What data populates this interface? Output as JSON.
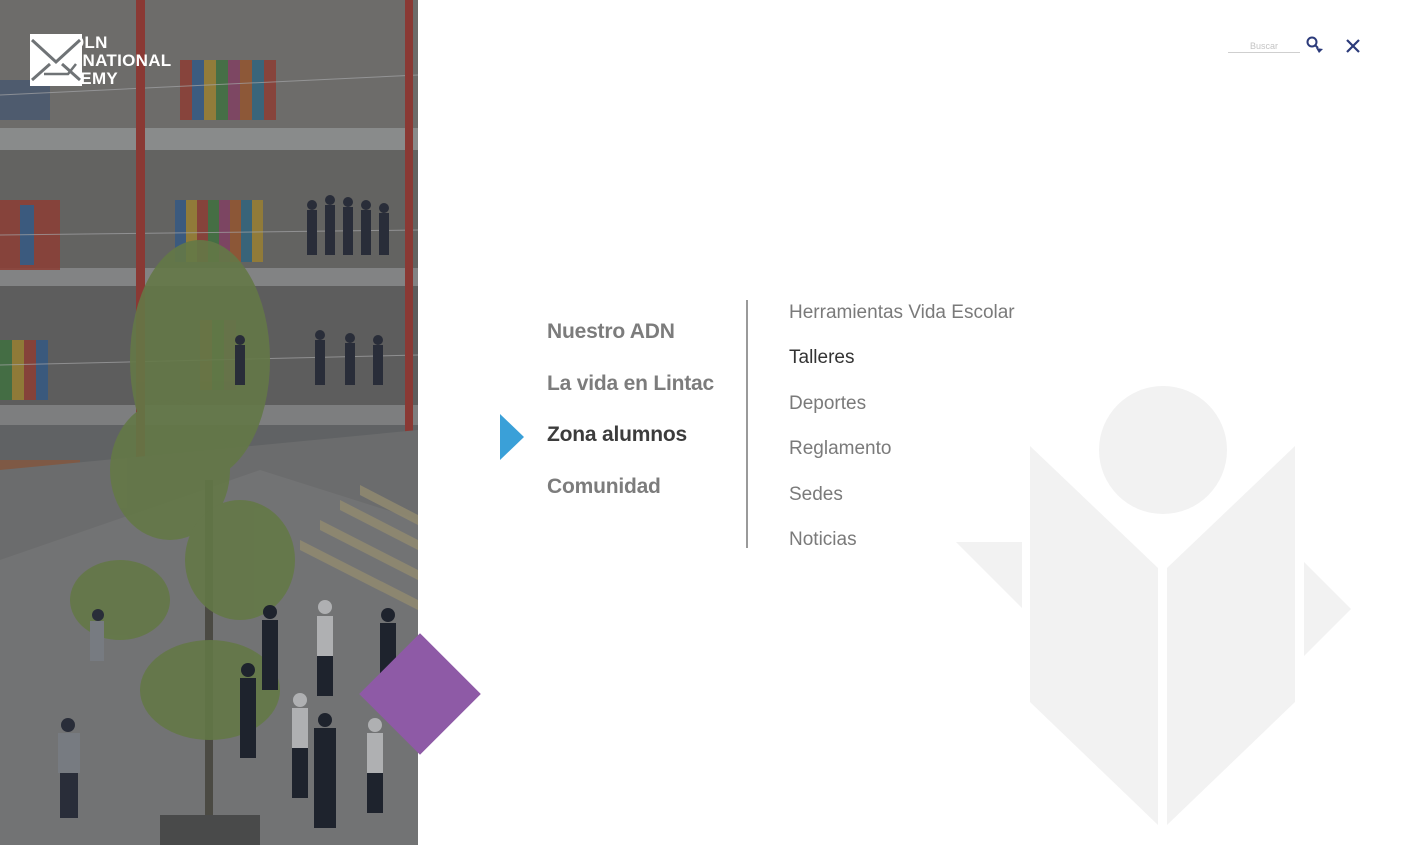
{
  "brand": {
    "name_line1": "LINCOLN",
    "name_line2": "INTERNATIONAL",
    "name_line3": "ACADEMY",
    "logo_icon": "envelope-mark-icon"
  },
  "search": {
    "placeholder": "Buscar",
    "icon": "search-icon"
  },
  "close": {
    "icon": "close-icon"
  },
  "main_menu": {
    "items": [
      {
        "label": "Nuestro ADN"
      },
      {
        "label": "La vida en Lintac"
      },
      {
        "label": "Zona alumnos"
      },
      {
        "label": "Comunidad"
      }
    ],
    "active_index": 2
  },
  "sub_menu": {
    "items": [
      {
        "label": "Herramientas Vida Escolar"
      },
      {
        "label": "Talleres"
      },
      {
        "label": "Deportes"
      },
      {
        "label": "Reglamento"
      },
      {
        "label": "Sedes"
      },
      {
        "label": "Noticias"
      }
    ],
    "highlighted_index": 1
  },
  "colors": {
    "accent_blue": "#3aa0d8",
    "accent_purple": "#8e5aa6",
    "close_navy": "#2b3a7a",
    "watermark": "#f2f2f2"
  }
}
